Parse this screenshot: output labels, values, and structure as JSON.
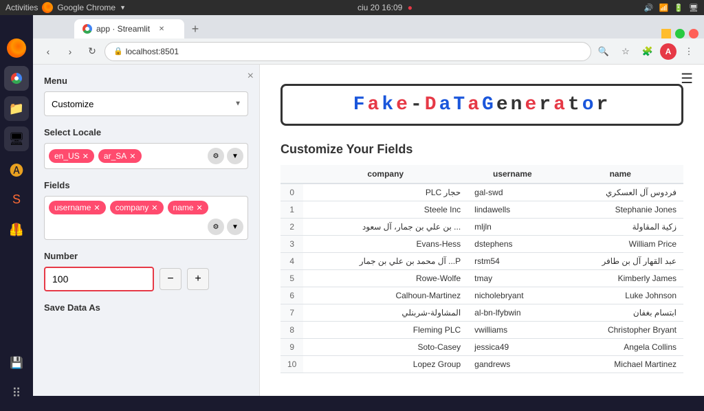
{
  "os": {
    "bar_label": "Activities",
    "app_name": "Google Chrome",
    "time": "ciu 20  16:09",
    "wifi": "wifi",
    "volume": "volume"
  },
  "browser": {
    "tab_title": "app · Streamlit",
    "url": "localhost:8501",
    "new_tab_label": "+"
  },
  "sidebar": {
    "close_label": "×",
    "menu_label": "Menu",
    "menu_value": "Customize",
    "locale_label": "Select Locale",
    "locale_tags": [
      {
        "id": "en_US",
        "label": "en_US"
      },
      {
        "id": "ar_SA",
        "label": "ar_SA"
      }
    ],
    "fields_label": "Fields",
    "field_tags": [
      {
        "id": "username",
        "label": "username"
      },
      {
        "id": "company",
        "label": "company"
      },
      {
        "id": "name",
        "label": "name"
      }
    ],
    "number_label": "Number",
    "number_value": "100",
    "save_label": "Save Data As"
  },
  "main": {
    "title": "Fake-DaTaGenerator",
    "section_title": "Customize Your Fields",
    "table": {
      "columns": [
        "",
        "company",
        "username",
        "name"
      ],
      "rows": [
        {
          "idx": "0",
          "company": "حجار PLC",
          "username": "gal-swd",
          "name": "فردوس آل العسكري"
        },
        {
          "idx": "1",
          "company": "Steele Inc",
          "username": "lindawells",
          "name": "Stephanie Jones"
        },
        {
          "idx": "2",
          "company": "... بن علي بن جمار، آل سعود",
          "username": "mljln",
          "name": "زكية المقاولة"
        },
        {
          "idx": "3",
          "company": "Evans-Hess",
          "username": "dstephens",
          "name": "William Price"
        },
        {
          "idx": "4",
          "company": "P... آل محمد بن علي بن جمار",
          "username": "rstm54",
          "name": "عبد القهار آل بن طافر"
        },
        {
          "idx": "5",
          "company": "Rowe-Wolfe",
          "username": "tmay",
          "name": "Kimberly James"
        },
        {
          "idx": "6",
          "company": "Calhoun-Martinez",
          "username": "nicholebryant",
          "name": "Luke Johnson"
        },
        {
          "idx": "7",
          "company": "المشاولة-شربنلي",
          "username": "al-bn-lfybwin",
          "name": "ابتسام بغفان"
        },
        {
          "idx": "8",
          "company": "Fleming PLC",
          "username": "vwilliams",
          "name": "Christopher Bryant"
        },
        {
          "idx": "9",
          "company": "Soto-Casey",
          "username": "jessica49",
          "name": "Angela Collins"
        },
        {
          "idx": "10",
          "company": "Lopez Group",
          "username": "gandrews",
          "name": "Michael Martinez"
        }
      ]
    }
  },
  "colors": {
    "accent": "#e63946",
    "tag_bg": "#ff4b6e",
    "title_blue": "#1a56db"
  }
}
